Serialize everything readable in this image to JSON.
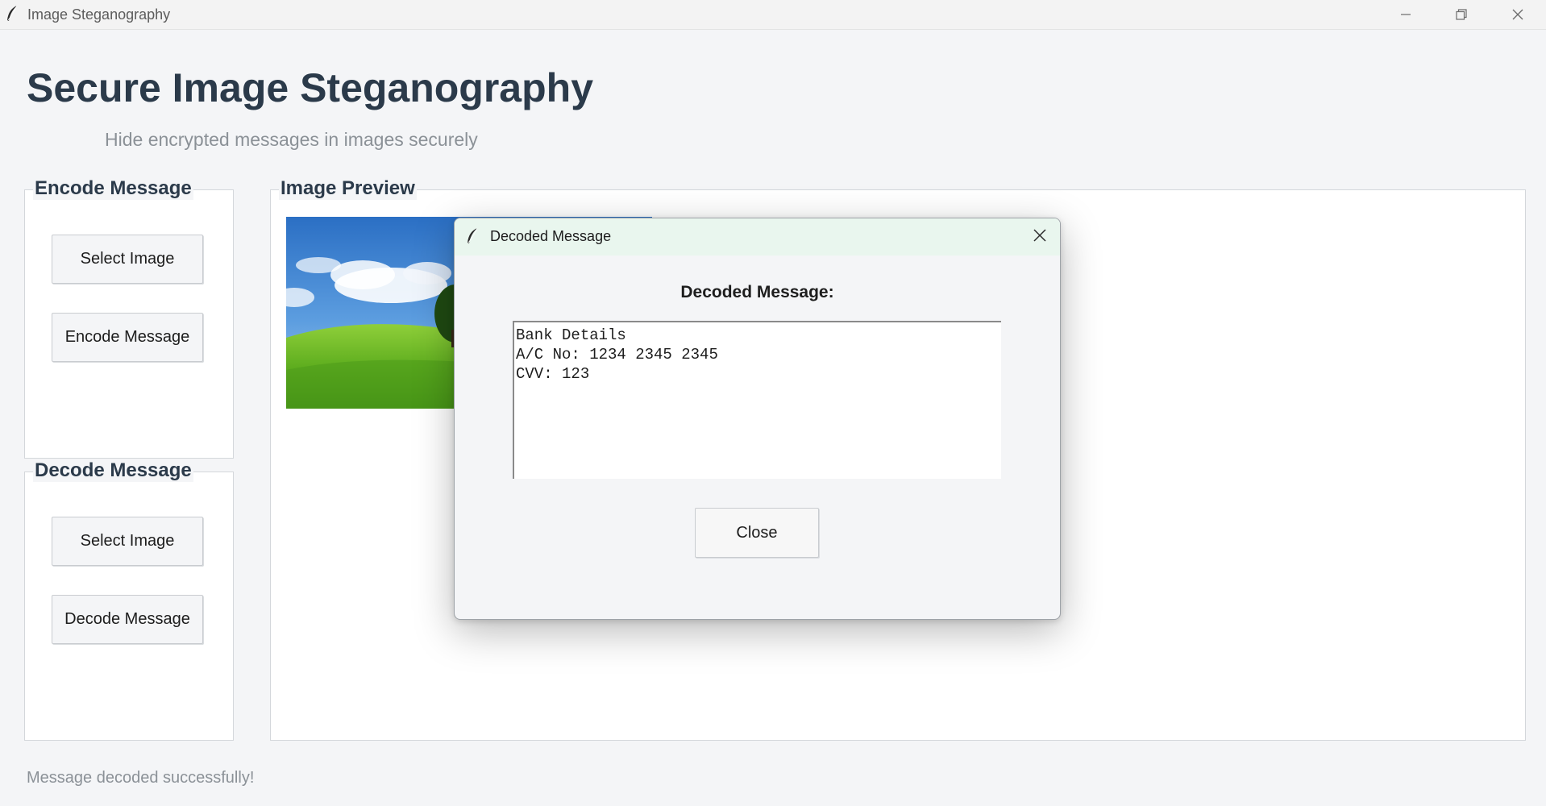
{
  "window": {
    "title": "Image Steganography",
    "controls": [
      "minimize-icon",
      "restore-icon",
      "close-icon"
    ]
  },
  "header": {
    "title": "Secure Image Steganography",
    "subtitle": "Hide encrypted messages in images securely"
  },
  "encode_panel": {
    "label": "Encode Message",
    "select_image_label": "Select Image",
    "action_label": "Encode Message"
  },
  "decode_panel": {
    "label": "Decode Message",
    "select_image_label": "Select Image",
    "action_label": "Decode Message"
  },
  "preview_panel": {
    "label": "Image Preview"
  },
  "status": {
    "text": "Message decoded successfully!"
  },
  "dialog": {
    "title": "Decoded Message",
    "heading": "Decoded Message:",
    "message": "Bank Details\nA/C No: 1234 2345 2345\nCVV: 123",
    "close_label": "Close"
  },
  "colors": {
    "background": "#f4f5f7",
    "title_text": "#2b3a4a",
    "subtitle_text": "#8b9197",
    "dialog_titlebar": "#e9f6ee"
  }
}
